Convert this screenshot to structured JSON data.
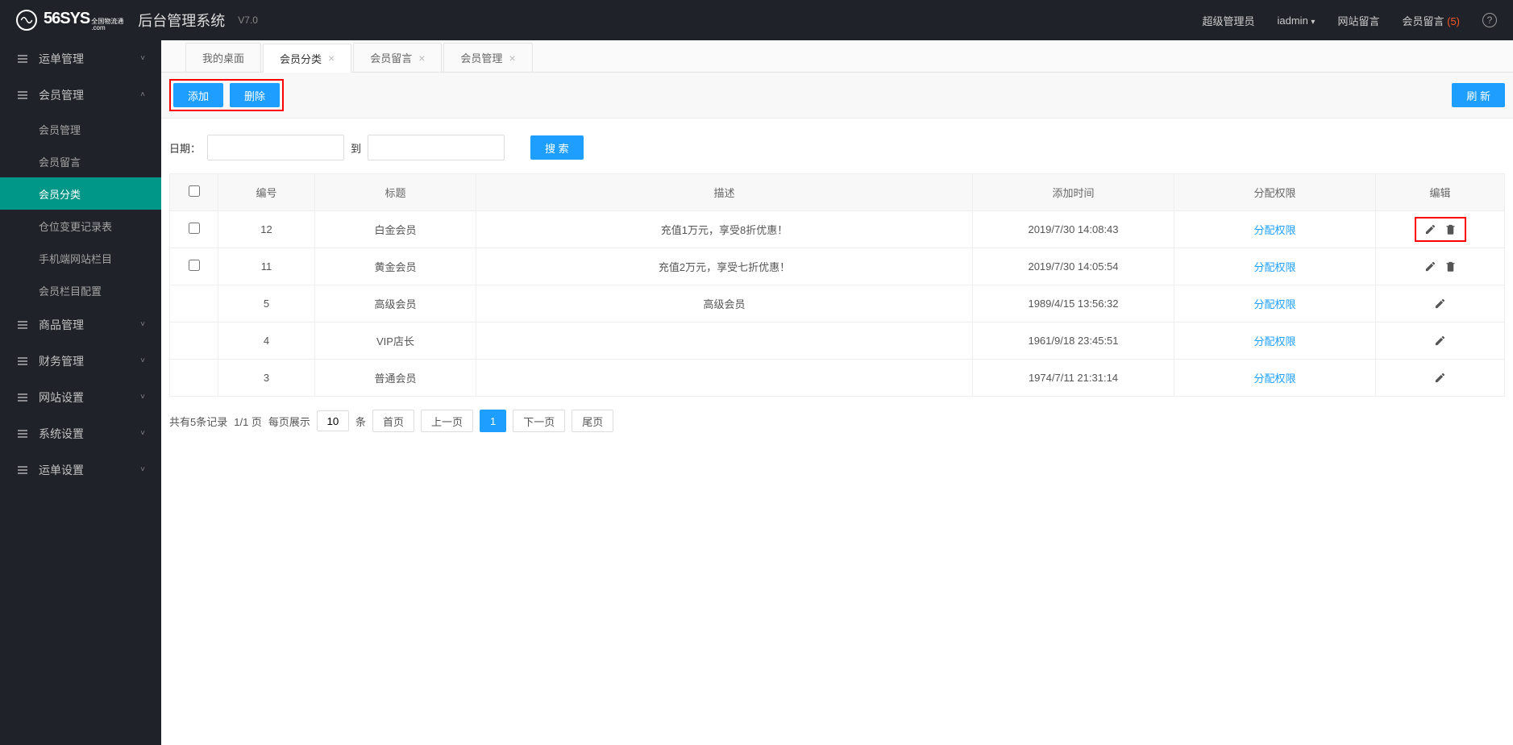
{
  "header": {
    "logo_text": "56SYS",
    "logo_sub_top": "全国物流通",
    "logo_sub_bot": ".com",
    "system_title": "后台管理系统",
    "version": "V7.0",
    "role": "超级管理员",
    "username": "iadmin",
    "site_msg": "网站留言",
    "member_msg": "会员留言",
    "member_msg_count": "(5)"
  },
  "sidebar": {
    "items": [
      {
        "label": "运单管理",
        "expanded": false
      },
      {
        "label": "会员管理",
        "expanded": true,
        "children": [
          {
            "label": "会员管理",
            "active": false
          },
          {
            "label": "会员留言",
            "active": false
          },
          {
            "label": "会员分类",
            "active": true
          },
          {
            "label": "仓位变更记录表",
            "active": false
          },
          {
            "label": "手机端网站栏目",
            "active": false
          },
          {
            "label": "会员栏目配置",
            "active": false
          }
        ]
      },
      {
        "label": "商品管理",
        "expanded": false
      },
      {
        "label": "财务管理",
        "expanded": false
      },
      {
        "label": "网站设置",
        "expanded": false
      },
      {
        "label": "系统设置",
        "expanded": false
      },
      {
        "label": "运单设置",
        "expanded": false
      }
    ]
  },
  "tabs": [
    {
      "label": "我的桌面",
      "active": false,
      "closable": false
    },
    {
      "label": "会员分类",
      "active": true,
      "closable": true
    },
    {
      "label": "会员留言",
      "active": false,
      "closable": true
    },
    {
      "label": "会员管理",
      "active": false,
      "closable": true
    }
  ],
  "toolbar": {
    "add_label": "添加",
    "delete_label": "删除",
    "refresh_label": "刷 新"
  },
  "search": {
    "date_label": "日期：",
    "to_label": "到",
    "search_label": "搜 索"
  },
  "table": {
    "headers": {
      "id": "编号",
      "title": "标题",
      "desc": "描述",
      "time": "添加时间",
      "perm": "分配权限",
      "edit": "编辑"
    },
    "perm_link_label": "分配权限",
    "rows": [
      {
        "id": "12",
        "title": "白金会员",
        "desc": "充值1万元，享受8折优惠！",
        "time": "2019/7/30 14:08:43",
        "has_checkbox": true,
        "has_delete": true,
        "highlight": true
      },
      {
        "id": "11",
        "title": "黄金会员",
        "desc": "充值2万元，享受七折优惠！",
        "time": "2019/7/30 14:05:54",
        "has_checkbox": true,
        "has_delete": true,
        "highlight": false
      },
      {
        "id": "5",
        "title": "高级会员",
        "desc": "高级会员",
        "time": "1989/4/15 13:56:32",
        "has_checkbox": false,
        "has_delete": false,
        "highlight": false
      },
      {
        "id": "4",
        "title": "VIP店长",
        "desc": "",
        "time": "1961/9/18 23:45:51",
        "has_checkbox": false,
        "has_delete": false,
        "highlight": false
      },
      {
        "id": "3",
        "title": "普通会员",
        "desc": "",
        "time": "1974/7/11 21:31:14",
        "has_checkbox": false,
        "has_delete": false,
        "highlight": false
      }
    ]
  },
  "pagination": {
    "summary_prefix": "共有5条记录",
    "pages": "1/1 页",
    "per_page_label": "每页展示",
    "per_page_value": "10",
    "per_page_suffix": "条",
    "first": "首页",
    "prev": "上一页",
    "current": "1",
    "next": "下一页",
    "last": "尾页"
  }
}
